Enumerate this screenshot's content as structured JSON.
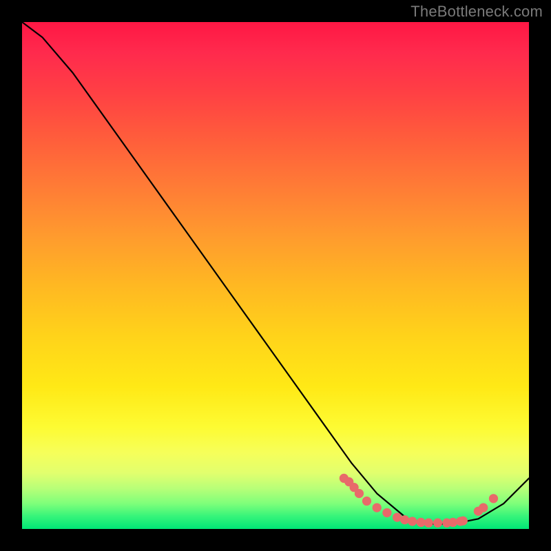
{
  "watermark": "TheBottleneck.com",
  "chart_data": {
    "type": "line",
    "title": "",
    "xlabel": "",
    "ylabel": "",
    "xlim": [
      0,
      1
    ],
    "ylim": [
      0,
      1
    ],
    "x": [
      0.0,
      0.04,
      0.1,
      0.2,
      0.3,
      0.4,
      0.5,
      0.6,
      0.65,
      0.7,
      0.76,
      0.8,
      0.85,
      0.9,
      0.95,
      1.0
    ],
    "y": [
      1.0,
      0.97,
      0.9,
      0.76,
      0.62,
      0.48,
      0.34,
      0.2,
      0.13,
      0.07,
      0.02,
      0.01,
      0.01,
      0.02,
      0.05,
      0.1
    ],
    "markers": [
      {
        "x": 0.635,
        "y": 0.1
      },
      {
        "x": 0.645,
        "y": 0.093
      },
      {
        "x": 0.655,
        "y": 0.082
      },
      {
        "x": 0.665,
        "y": 0.07
      },
      {
        "x": 0.68,
        "y": 0.055
      },
      {
        "x": 0.7,
        "y": 0.042
      },
      {
        "x": 0.72,
        "y": 0.032
      },
      {
        "x": 0.74,
        "y": 0.023
      },
      {
        "x": 0.755,
        "y": 0.018
      },
      {
        "x": 0.77,
        "y": 0.015
      },
      {
        "x": 0.787,
        "y": 0.013
      },
      {
        "x": 0.802,
        "y": 0.012
      },
      {
        "x": 0.82,
        "y": 0.012
      },
      {
        "x": 0.838,
        "y": 0.012
      },
      {
        "x": 0.85,
        "y": 0.013
      },
      {
        "x": 0.865,
        "y": 0.015
      },
      {
        "x": 0.87,
        "y": 0.016
      },
      {
        "x": 0.9,
        "y": 0.035
      },
      {
        "x": 0.91,
        "y": 0.042
      },
      {
        "x": 0.93,
        "y": 0.06
      }
    ],
    "marker_color": "#e86a6a",
    "marker_radius_rel": 0.009,
    "line_color": "#000000",
    "gradient_stops": [
      {
        "pos": 0.0,
        "color": "#ff1744"
      },
      {
        "pos": 0.5,
        "color": "#ffb822"
      },
      {
        "pos": 0.8,
        "color": "#fdfb33"
      },
      {
        "pos": 1.0,
        "color": "#00e676"
      }
    ]
  }
}
